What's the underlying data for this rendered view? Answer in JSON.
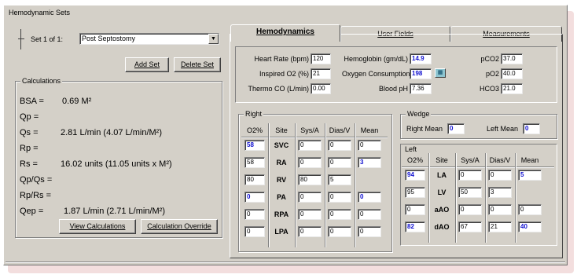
{
  "window": {
    "title": "Hemodynamic Sets"
  },
  "setSelector": {
    "label": "Set 1 of 1:",
    "value": "Post Septostomy"
  },
  "buttons": {
    "addSet": "Add Set",
    "deleteSet": "Delete Set",
    "viewCalc": "View Calculations",
    "calcOverride": "Calculation Override"
  },
  "calculations": {
    "title": "Calculations",
    "rows": [
      {
        "key": "BSA =",
        "value": "0.69 M²"
      },
      {
        "key": "Qp =",
        "value": ""
      },
      {
        "key": "Qs =",
        "value": "2.81 L/min (4.07 L/min/M²)"
      },
      {
        "key": "Rp =",
        "value": ""
      },
      {
        "key": "Rs =",
        "value": "16.02 units (11.05 units x M²)"
      },
      {
        "key": "Qp/Qs =",
        "value": ""
      },
      {
        "key": "Rp/Rs =",
        "value": ""
      },
      {
        "key": "Qep =",
        "value": "1.87 L/min (2.71 L/min/M²)"
      }
    ]
  },
  "tabs": [
    {
      "label": "Hemodynamics",
      "active": true
    },
    {
      "label": "User Fields",
      "active": false
    },
    {
      "label": "Measurements",
      "active": false
    }
  ],
  "vitals": {
    "heartRate": {
      "label": "Heart Rate (bpm)",
      "value": "120"
    },
    "inspiredO2": {
      "label": "Inspired O2 (%)",
      "value": "21"
    },
    "thermoCO": {
      "label": "Thermo CO (L/min)",
      "value": "0.00"
    },
    "hemoglobin": {
      "label": "Hemoglobin (gm/dL)",
      "value": "14.9"
    },
    "o2Consumption": {
      "label": "Oxygen Consumption",
      "value": "198"
    },
    "bloodPh": {
      "label": "Blood pH",
      "value": "7.36"
    },
    "pCO2": {
      "label": "pCO2",
      "value": "37.0"
    },
    "pO2": {
      "label": "pO2",
      "value": "40.0"
    },
    "hco3": {
      "label": "HCO3",
      "value": "21.0"
    },
    "o2ConsumptionIcon": "calculator-icon"
  },
  "right": {
    "title": "Right",
    "headers": [
      "O2%",
      "Site",
      "Sys/A",
      "Dias/V",
      "Mean"
    ],
    "rows": [
      {
        "o2": "58",
        "site": "SVC",
        "sys": "0",
        "dias": "0",
        "mean": "0",
        "o2Blue": true,
        "meanBlue": false
      },
      {
        "o2": "58",
        "site": "RA",
        "sys": "0",
        "dias": "0",
        "mean": "3",
        "o2Blue": false,
        "meanBlue": true
      },
      {
        "o2": "80",
        "site": "RV",
        "sys": "80",
        "dias": "5",
        "mean": "",
        "o2Blue": false,
        "meanBlue": false
      },
      {
        "o2": "0",
        "site": "PA",
        "sys": "0",
        "dias": "0",
        "mean": "0",
        "o2Blue": true,
        "meanBlue": true
      },
      {
        "o2": "0",
        "site": "RPA",
        "sys": "0",
        "dias": "0",
        "mean": "0",
        "o2Blue": false,
        "meanBlue": false
      },
      {
        "o2": "0",
        "site": "LPA",
        "sys": "0",
        "dias": "0",
        "mean": "0",
        "o2Blue": false,
        "meanBlue": false
      }
    ]
  },
  "wedge": {
    "title": "Wedge",
    "rightMeanLabel": "Right Mean",
    "rightMean": "0",
    "leftMeanLabel": "Left Mean",
    "leftMean": "0"
  },
  "left": {
    "title": "Left",
    "headers": [
      "O2%",
      "Site",
      "Sys/A",
      "Dias/V",
      "Mean"
    ],
    "rows": [
      {
        "o2": "94",
        "site": "LA",
        "sys": "0",
        "dias": "0",
        "mean": "5",
        "o2Blue": true,
        "meanBlue": true
      },
      {
        "o2": "95",
        "site": "LV",
        "sys": "50",
        "dias": "3",
        "mean": "",
        "o2Blue": false,
        "meanBlue": false
      },
      {
        "o2": "0",
        "site": "aAO",
        "sys": "0",
        "dias": "0",
        "mean": "0",
        "o2Blue": false,
        "meanBlue": false
      },
      {
        "o2": "82",
        "site": "dAO",
        "sys": "67",
        "dias": "21",
        "mean": "40",
        "o2Blue": true,
        "meanBlue": true
      }
    ]
  },
  "colors": {
    "windowBg": "#d4d0c8",
    "valueBlue": "#1010d0",
    "shadowPink": "#f3dede"
  }
}
